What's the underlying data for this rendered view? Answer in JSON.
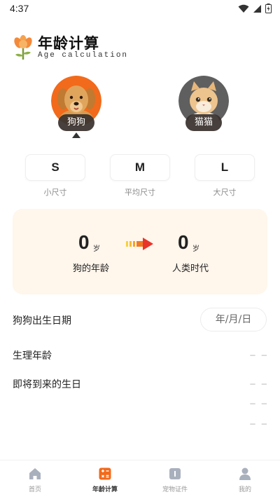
{
  "status_bar": {
    "time": "4:37"
  },
  "header": {
    "title": "年龄计算",
    "subtitle": "Age calculation"
  },
  "pets": [
    {
      "label": "狗狗",
      "selected": true
    },
    {
      "label": "猫猫",
      "selected": false
    }
  ],
  "sizes": [
    {
      "letter": "S",
      "caption": "小尺寸"
    },
    {
      "letter": "M",
      "caption": "平均尺寸"
    },
    {
      "letter": "L",
      "caption": "大尺寸"
    }
  ],
  "result": {
    "pet_age": "0",
    "pet_unit": "岁",
    "pet_caption": "狗的年龄",
    "human_age": "0",
    "human_unit": "岁",
    "human_caption": "人类时代"
  },
  "rows": {
    "birth_label": "狗狗出生日期",
    "birth_placeholder": "年/月/日",
    "physio_label": "生理年龄",
    "physio_value": "— —",
    "next_birthday_label": "即将到来的生日",
    "next_birthday_value": "— —",
    "extra_value_1": "— —",
    "extra_value_2": "— —"
  },
  "nav": [
    {
      "label": "首页",
      "icon": "home-icon"
    },
    {
      "label": "年龄计算",
      "icon": "calculator-icon",
      "active": true
    },
    {
      "label": "宠物证件",
      "icon": "id-card-icon"
    },
    {
      "label": "我的",
      "icon": "profile-icon"
    }
  ],
  "colors": {
    "accent": "#f26a1b",
    "card_bg": "#fff6ec",
    "nav_active": "#f26a1b"
  }
}
